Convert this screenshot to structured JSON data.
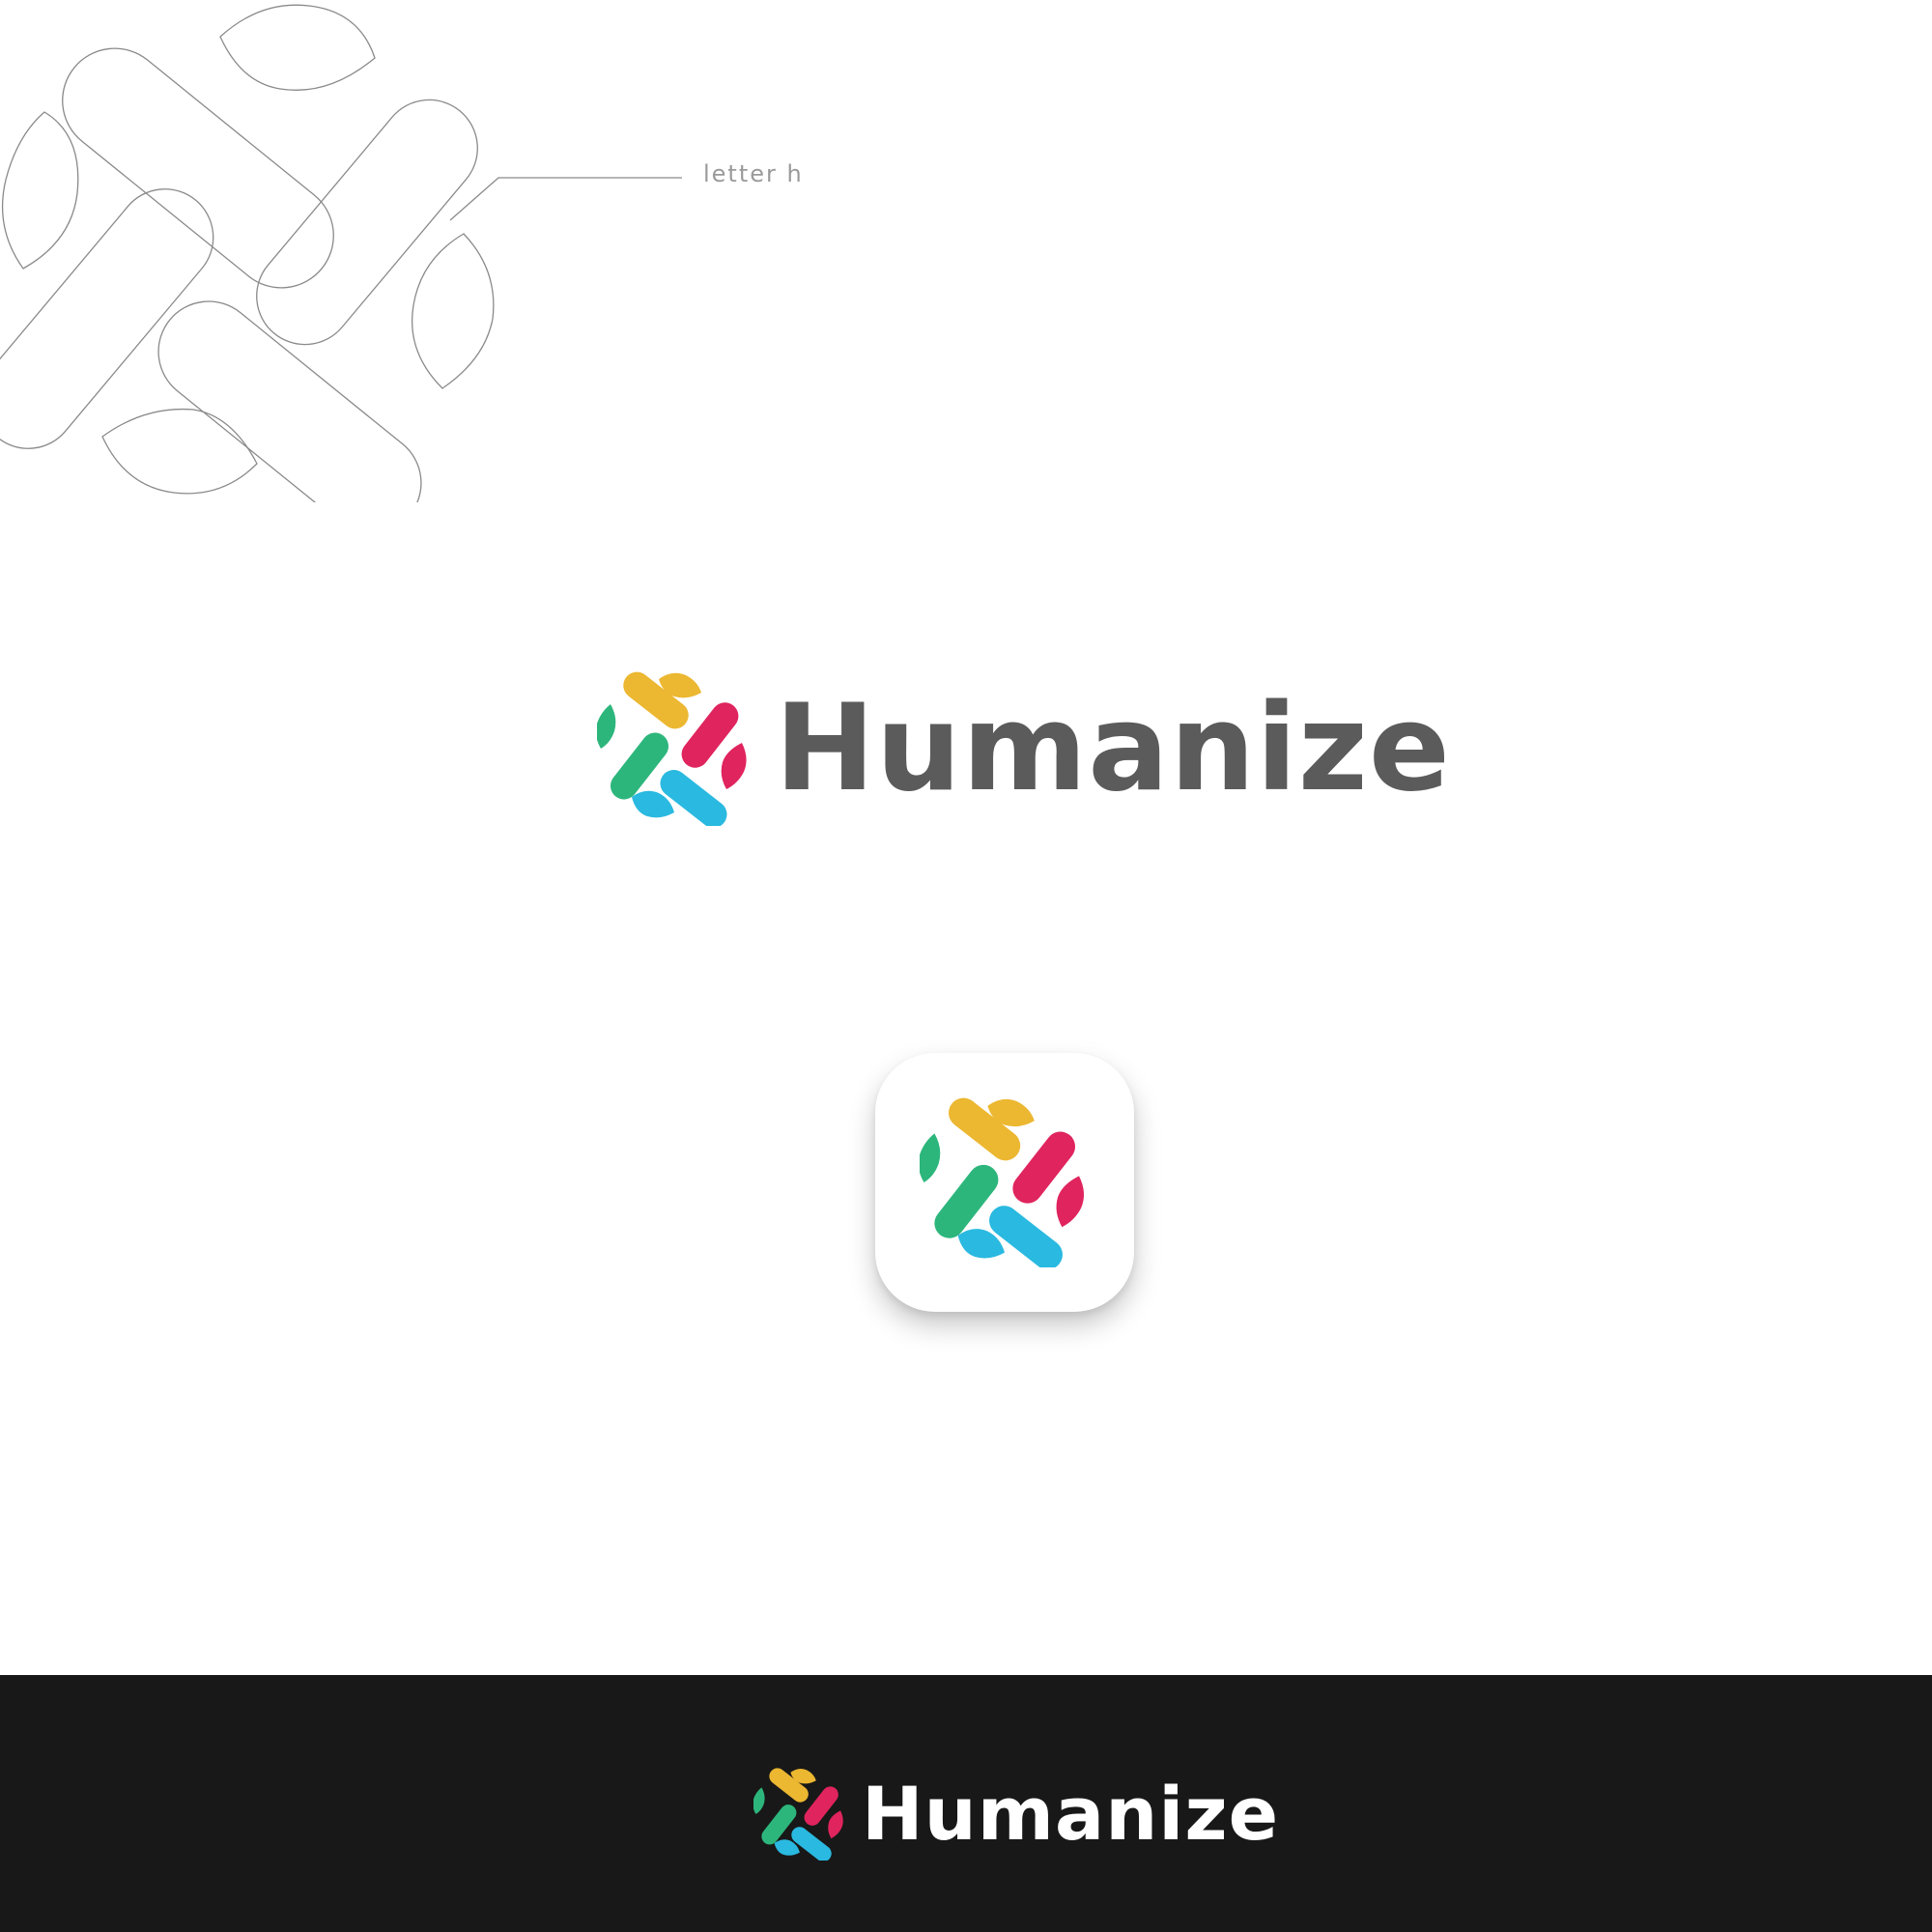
{
  "sketch": {
    "label": "letter h"
  },
  "brand": {
    "name": "Humanize",
    "colors": {
      "yellow": "#ecb731",
      "pink": "#e0245e",
      "green": "#2db67c",
      "cyan": "#2ab9e0",
      "wordmark_dark": "#5b5b5b",
      "wordmark_light": "#ffffff",
      "band": "#181818",
      "outline": "#8a8a8a"
    }
  },
  "main_logo": {
    "icon": "humanize-mark-icon"
  },
  "app_icon": {
    "icon": "humanize-mark-icon"
  },
  "dark_logo": {
    "icon": "humanize-mark-icon"
  }
}
